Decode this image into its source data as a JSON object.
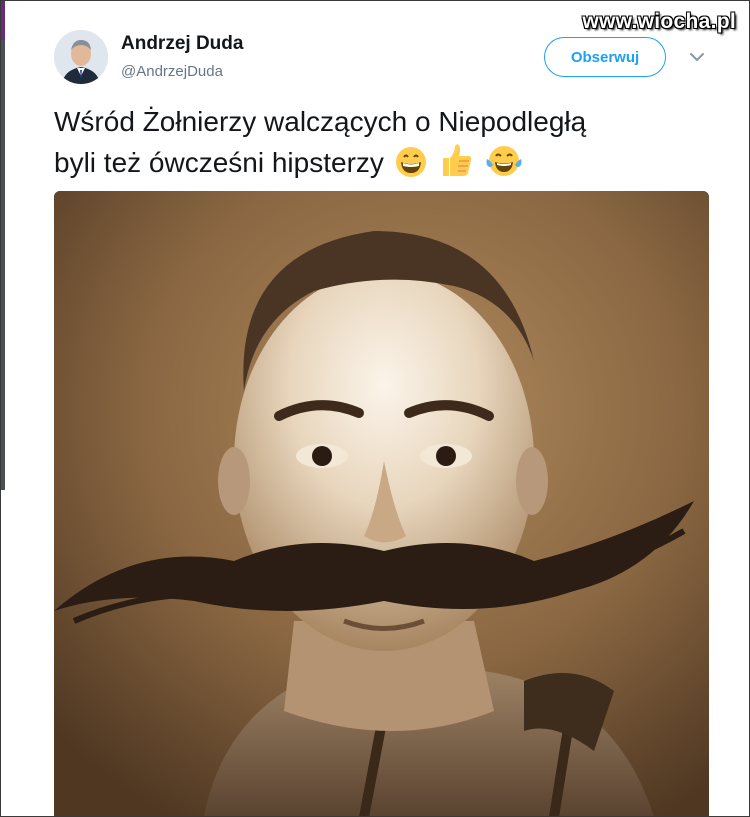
{
  "watermark": "www.wiocha.pl",
  "author": {
    "name": "Andrzej Duda",
    "handle": "@AndrzejDuda"
  },
  "follow_button": "Obserwuj",
  "tweet": {
    "line1": "Wśród Żołnierzy walczących o Niepodległą",
    "line2": "byli też ówcześni hipsterzy"
  },
  "icons": [
    "grinning-emoji",
    "thumbs-up-emoji",
    "tears-of-joy-emoji",
    "chevron-down-icon"
  ],
  "colors": {
    "accent": "#1da1f2",
    "handle": "#657786",
    "text": "#14171a",
    "photo_sepia": "#8a6a47"
  }
}
